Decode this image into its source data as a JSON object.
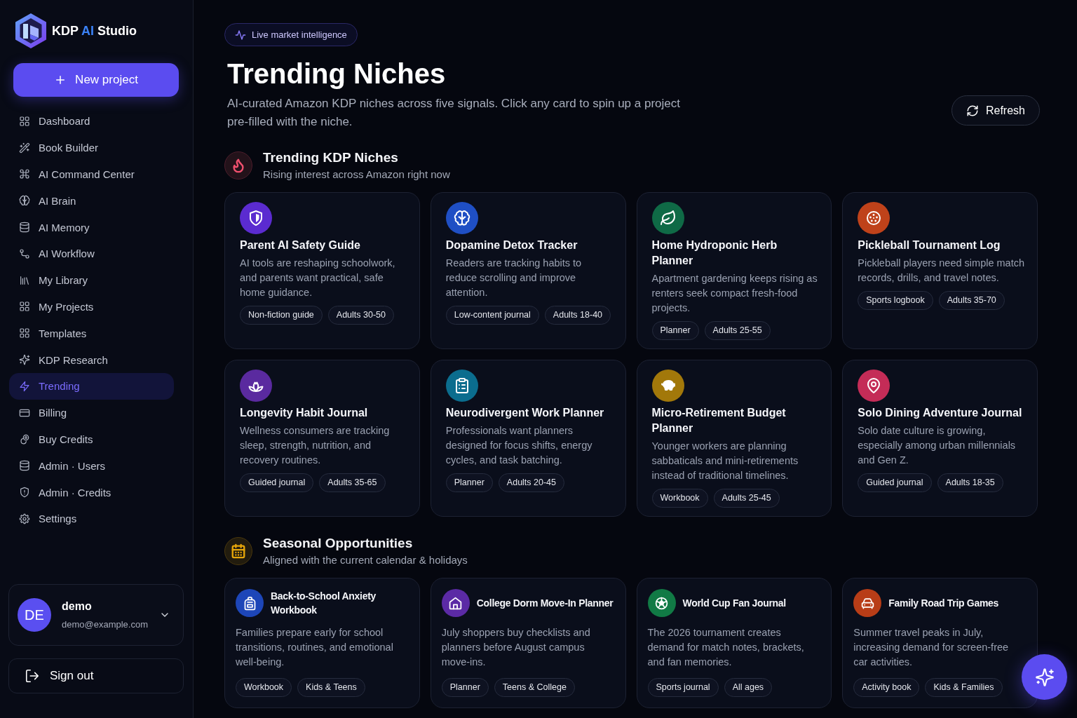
{
  "sidebar": {
    "brand": {
      "prefix": "KDP",
      "accent": "AI",
      "suffix": "Studio"
    },
    "new_project_button": "New project",
    "nav_items": [
      {
        "label": "Dashboard",
        "selected": false
      },
      {
        "label": "Book Builder",
        "selected": false
      },
      {
        "label": "AI Command Center",
        "selected": false
      },
      {
        "label": "AI Brain",
        "selected": false
      },
      {
        "label": "AI Memory",
        "selected": false
      },
      {
        "label": "AI Workflow",
        "selected": false
      },
      {
        "label": "My Library",
        "selected": false
      },
      {
        "label": "My Projects",
        "selected": false
      },
      {
        "label": "Templates",
        "selected": false
      },
      {
        "label": "KDP Research",
        "selected": false
      },
      {
        "label": "Trending",
        "selected": true
      },
      {
        "label": "Billing",
        "selected": false
      },
      {
        "label": "Buy Credits",
        "selected": false
      },
      {
        "label": "Admin · Users",
        "selected": false
      },
      {
        "label": "Admin · Credits",
        "selected": false
      },
      {
        "label": "Settings",
        "selected": false
      }
    ],
    "user": {
      "initials": "DE",
      "name": "demo",
      "email": "demo@example.com"
    },
    "sign_out_button": "Sign out"
  },
  "header": {
    "badge": "Live market intelligence",
    "title": "Trending Niches",
    "subtitle": "AI-curated Amazon KDP niches across five signals. Click any card to spin up a project pre-filled with the niche.",
    "refresh_button": "Refresh"
  },
  "sections": [
    {
      "kind": "stacked",
      "title": "Trending KDP Niches",
      "subtitle": "Rising interest across Amazon right now",
      "color": "#f0506e",
      "cards": [
        {
          "title": "Parent AI Safety Guide",
          "description": "AI tools are reshaping schoolwork, and parents want practical, safe home guidance.",
          "tags": [
            "Non-fiction guide",
            "Adults 30-50"
          ],
          "color": "#5b2bd0"
        },
        {
          "title": "Dopamine Detox Tracker",
          "description": "Readers are tracking habits to reduce scrolling and improve attention.",
          "tags": [
            "Low-content journal",
            "Adults 18-40"
          ],
          "color": "#1f4fc4"
        },
        {
          "title": "Home Hydroponic Herb Planner",
          "description": "Apartment gardening keeps rising as renters seek compact fresh-food projects.",
          "tags": [
            "Planner",
            "Adults 25-55"
          ],
          "color": "#0f6a46"
        },
        {
          "title": "Pickleball Tournament Log",
          "description": "Pickleball players need simple match records, drills, and travel notes.",
          "tags": [
            "Sports logbook",
            "Adults 35-70"
          ],
          "color": "#bf421a"
        },
        {
          "title": "Longevity Habit Journal",
          "description": "Wellness consumers are tracking sleep, strength, nutrition, and recovery routines.",
          "tags": [
            "Guided journal",
            "Adults 35-65"
          ],
          "color": "#5a2a9f"
        },
        {
          "title": "Neurodivergent Work Planner",
          "description": "Professionals want planners designed for focus shifts, energy cycles, and task batching.",
          "tags": [
            "Planner",
            "Adults 20-45"
          ],
          "color": "#0b6d8e"
        },
        {
          "title": "Micro-Retirement Budget Planner",
          "description": "Younger workers are planning sabbaticals and mini-retirements instead of traditional timelines.",
          "tags": [
            "Workbook",
            "Adults 25-45"
          ],
          "color": "#a2780a"
        },
        {
          "title": "Solo Dining Adventure Journal",
          "description": "Solo date culture is growing, especially among urban millennials and Gen Z.",
          "tags": [
            "Guided journal",
            "Adults 18-35"
          ],
          "color": "#c42c57"
        }
      ]
    },
    {
      "kind": "inline",
      "title": "Seasonal Opportunities",
      "subtitle": "Aligned with the current calendar & holidays",
      "color": "#e5a50a",
      "cards": [
        {
          "title": "Back-to-School Anxiety Workbook",
          "description": "Families prepare early for school transitions, routines, and emotional well-being.",
          "tags": [
            "Workbook",
            "Kids & Teens"
          ],
          "color": "#1d46b8"
        },
        {
          "title": "College Dorm Move-In Planner",
          "description": "July shoppers buy checklists and planners before August campus move-ins.",
          "tags": [
            "Planner",
            "Teens & College"
          ],
          "color": "#5b2aa5"
        },
        {
          "title": "World Cup Fan Journal",
          "description": "The 2026 tournament creates demand for match notes, brackets, and fan memories.",
          "tags": [
            "Sports journal",
            "All ages"
          ],
          "color": "#117a45"
        },
        {
          "title": "Family Road Trip Games",
          "description": "Summer travel peaks in July, increasing demand for screen-free car activities.",
          "tags": [
            "Activity book",
            "Kids & Families"
          ],
          "color": "#b83d17"
        }
      ]
    }
  ]
}
